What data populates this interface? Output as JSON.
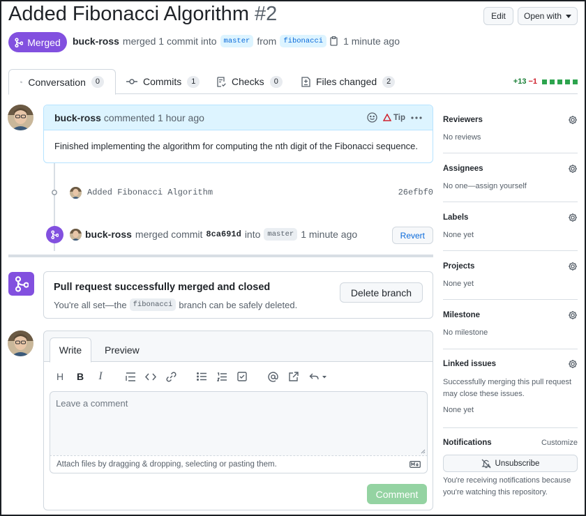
{
  "header": {
    "title": "Added Fibonacci Algorithm",
    "number": "#2",
    "edit_label": "Edit",
    "open_with_label": "Open with",
    "state_label": "Merged",
    "author": "buck-ross",
    "merge_text": "merged 1 commit into",
    "base_branch": "master",
    "from_text": "from",
    "head_branch": "fibonacci",
    "time": "1 minute ago"
  },
  "tabs": [
    {
      "label": "Conversation",
      "count": "0"
    },
    {
      "label": "Commits",
      "count": "1"
    },
    {
      "label": "Checks",
      "count": "0"
    },
    {
      "label": "Files changed",
      "count": "2"
    }
  ],
  "diffstat": {
    "added": "+13",
    "removed": "−1",
    "add_color": "#2da44e"
  },
  "comment": {
    "author": "buck-ross",
    "meta": "commented 1 hour ago",
    "tip_label": "Tip",
    "body": "Finished implementing the algorithm for computing the nth digit of the Fibonacci sequence."
  },
  "commit": {
    "message": "Added Fibonacci Algorithm",
    "sha": "26efbf0"
  },
  "merge_event": {
    "author": "buck-ross",
    "text": "merged commit",
    "sha": "8ca691d",
    "into_text": "into",
    "branch": "master",
    "time": "1 minute ago",
    "revert_label": "Revert"
  },
  "merged_box": {
    "title": "Pull request successfully merged and closed",
    "desc_before": "You're all set—the",
    "branch": "fibonacci",
    "desc_after": "branch can be safely deleted.",
    "delete_label": "Delete branch"
  },
  "composer": {
    "write_tab": "Write",
    "preview_tab": "Preview",
    "toolbar_heading": "H",
    "toolbar_bold": "B",
    "toolbar_italic": "I",
    "placeholder": "Leave a comment",
    "attach_text": "Attach files by dragging & dropping, selecting or pasting them.",
    "submit_label": "Comment",
    "accent_color": "#94d3a2"
  },
  "sidebar": {
    "sections": [
      {
        "title": "Reviewers",
        "value": "No reviews"
      },
      {
        "title": "Assignees",
        "value": "No one—assign yourself"
      },
      {
        "title": "Labels",
        "value": "None yet"
      },
      {
        "title": "Projects",
        "value": "None yet"
      },
      {
        "title": "Milestone",
        "value": "No milestone"
      }
    ],
    "linked_issues": {
      "title": "Linked issues",
      "note": "Successfully merging this pull request may close these issues.",
      "value": "None yet"
    },
    "notifications": {
      "title": "Notifications",
      "customize_label": "Customize",
      "unsubscribe_label": "Unsubscribe",
      "note": "You're receiving notifications because you're watching this repository."
    }
  },
  "colors": {
    "merged_purple": "#8250df",
    "link_blue": "#0969da"
  }
}
